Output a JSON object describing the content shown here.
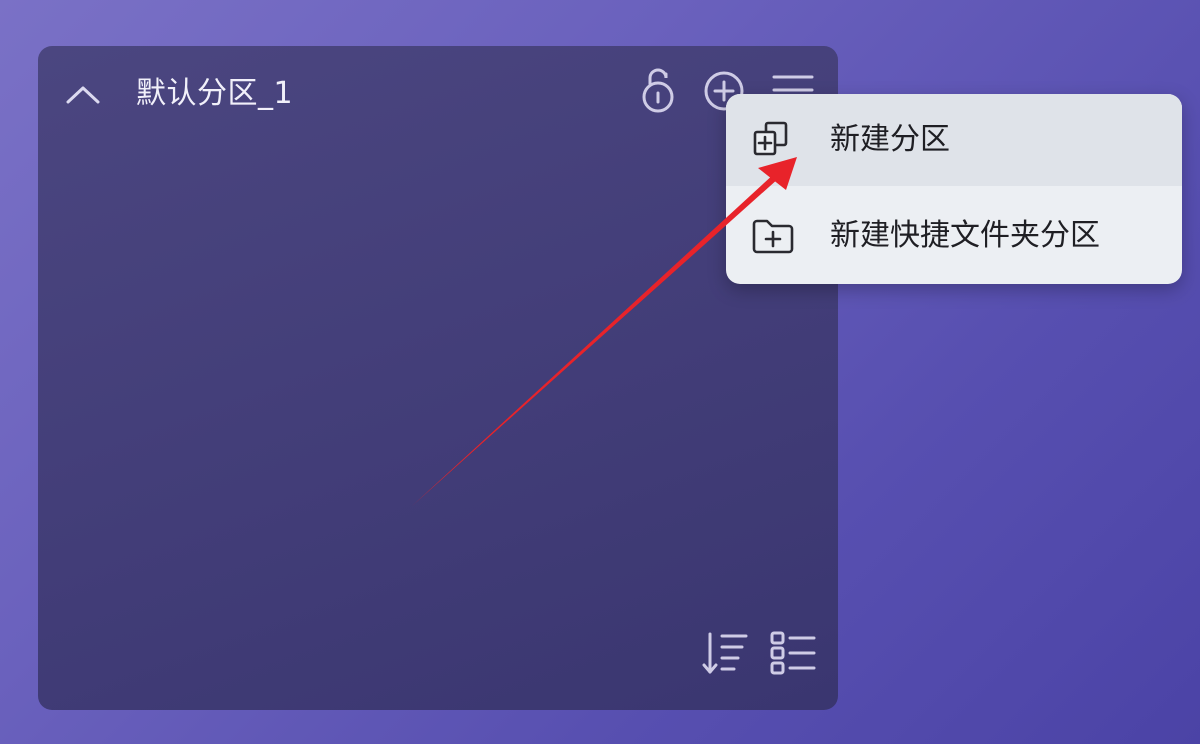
{
  "panel": {
    "title": "默认分区_1",
    "header_icons": [
      "chevron-up-icon",
      "unlock-icon",
      "add-circle-icon",
      "menu-icon"
    ],
    "footer_icons": [
      "sort-descending-icon",
      "list-view-icon"
    ]
  },
  "menu": {
    "items": [
      {
        "label": "新建分区",
        "icon": "new-partition-icon",
        "highlighted": true
      },
      {
        "label": "新建快捷文件夹分区",
        "icon": "new-folder-partition-icon",
        "highlighted": false
      }
    ]
  },
  "annotation": {
    "arrow_color": "#e8232a"
  },
  "colors": {
    "panel_bg": "#443f7a",
    "menu_bg": "#eceff3",
    "menu_hover": "#dfe3e9",
    "text_light": "#f1f0fa",
    "text_dark": "#1f1f24"
  }
}
